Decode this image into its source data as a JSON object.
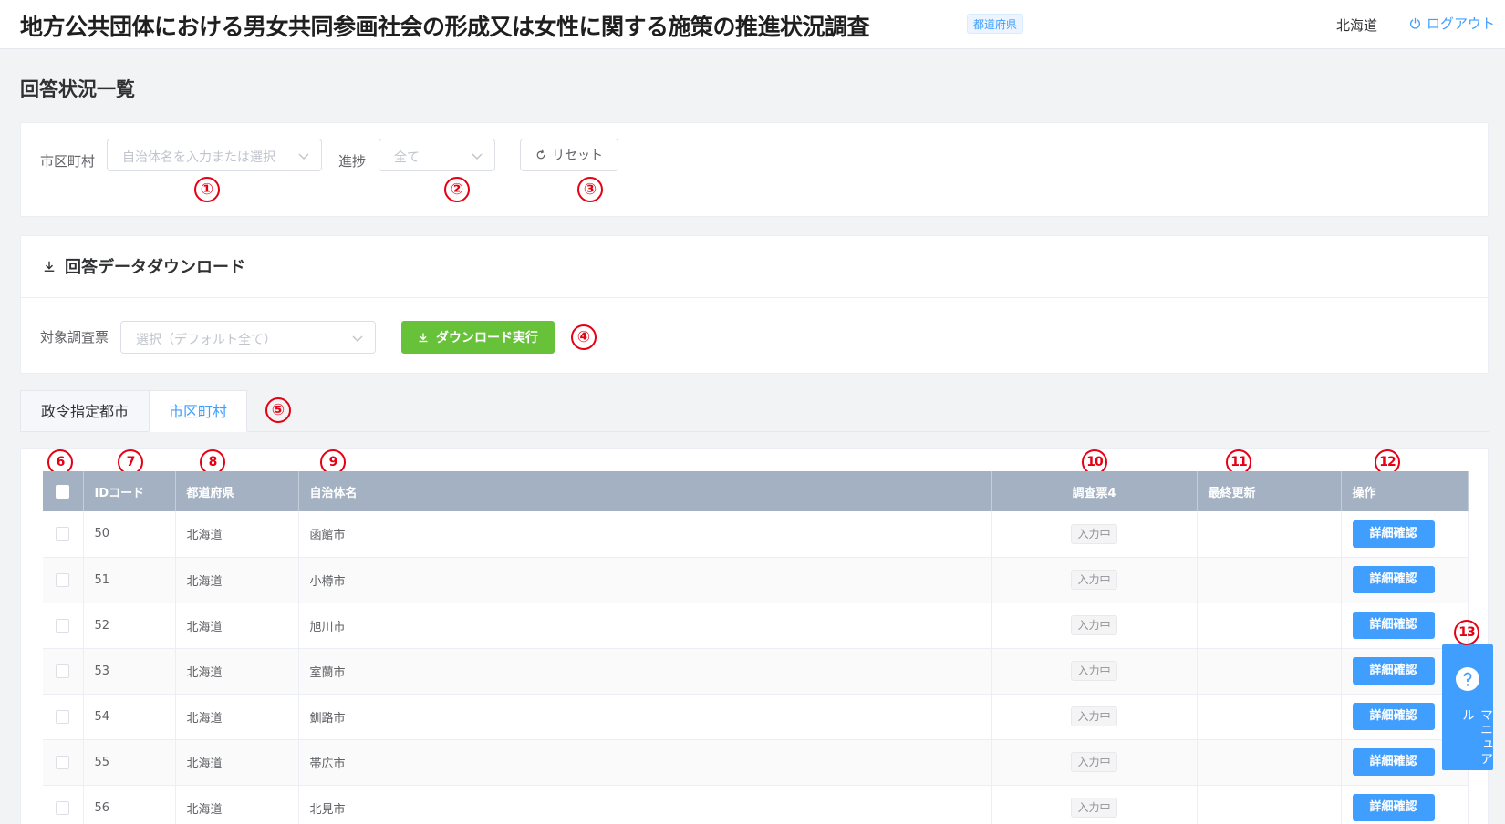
{
  "header": {
    "title": "地方公共団体における男女共同参画社会の形成又は女性に関する施策の推進状況調査",
    "role_badge": "都道府県",
    "user": "北海道",
    "logout": "ログアウト"
  },
  "page_title": "回答状況一覧",
  "filter": {
    "municipality_label": "市区町村",
    "municipality_placeholder": "自治体名を入力または選択",
    "progress_label": "進捗",
    "progress_value": "全て",
    "reset_label": "リセット"
  },
  "download": {
    "title": "回答データダウンロード",
    "target_label": "対象調査票",
    "target_placeholder": "選択（デフォルト全て）",
    "button_label": "ダウンロード実行"
  },
  "tabs": [
    "政令指定都市",
    "市区町村"
  ],
  "active_tab": "市区町村",
  "table": {
    "columns": [
      "IDコード",
      "都道府県",
      "自治体名",
      "調査票4",
      "最終更新",
      "操作"
    ],
    "rows": [
      {
        "id": "50",
        "pref": "北海道",
        "name": "函館市",
        "status": "入力中",
        "updated": "",
        "action": "詳細確認"
      },
      {
        "id": "51",
        "pref": "北海道",
        "name": "小樽市",
        "status": "入力中",
        "updated": "",
        "action": "詳細確認"
      },
      {
        "id": "52",
        "pref": "北海道",
        "name": "旭川市",
        "status": "入力中",
        "updated": "",
        "action": "詳細確認"
      },
      {
        "id": "53",
        "pref": "北海道",
        "name": "室蘭市",
        "status": "入力中",
        "updated": "",
        "action": "詳細確認"
      },
      {
        "id": "54",
        "pref": "北海道",
        "name": "釧路市",
        "status": "入力中",
        "updated": "",
        "action": "詳細確認"
      },
      {
        "id": "55",
        "pref": "北海道",
        "name": "帯広市",
        "status": "入力中",
        "updated": "",
        "action": "詳細確認"
      },
      {
        "id": "56",
        "pref": "北海道",
        "name": "北見市",
        "status": "入力中",
        "updated": "",
        "action": "詳細確認"
      }
    ]
  },
  "manual": {
    "label": "マニュアル",
    "icon": "question-icon"
  },
  "markers": [
    "①",
    "②",
    "③",
    "④",
    "⑤",
    "6",
    "7",
    "8",
    "9",
    "10",
    "11",
    "12",
    "13"
  ],
  "colors": {
    "primary": "#409eff",
    "success": "#67c23a",
    "marker": "#e60012",
    "table_header": "#a3b1c2"
  }
}
